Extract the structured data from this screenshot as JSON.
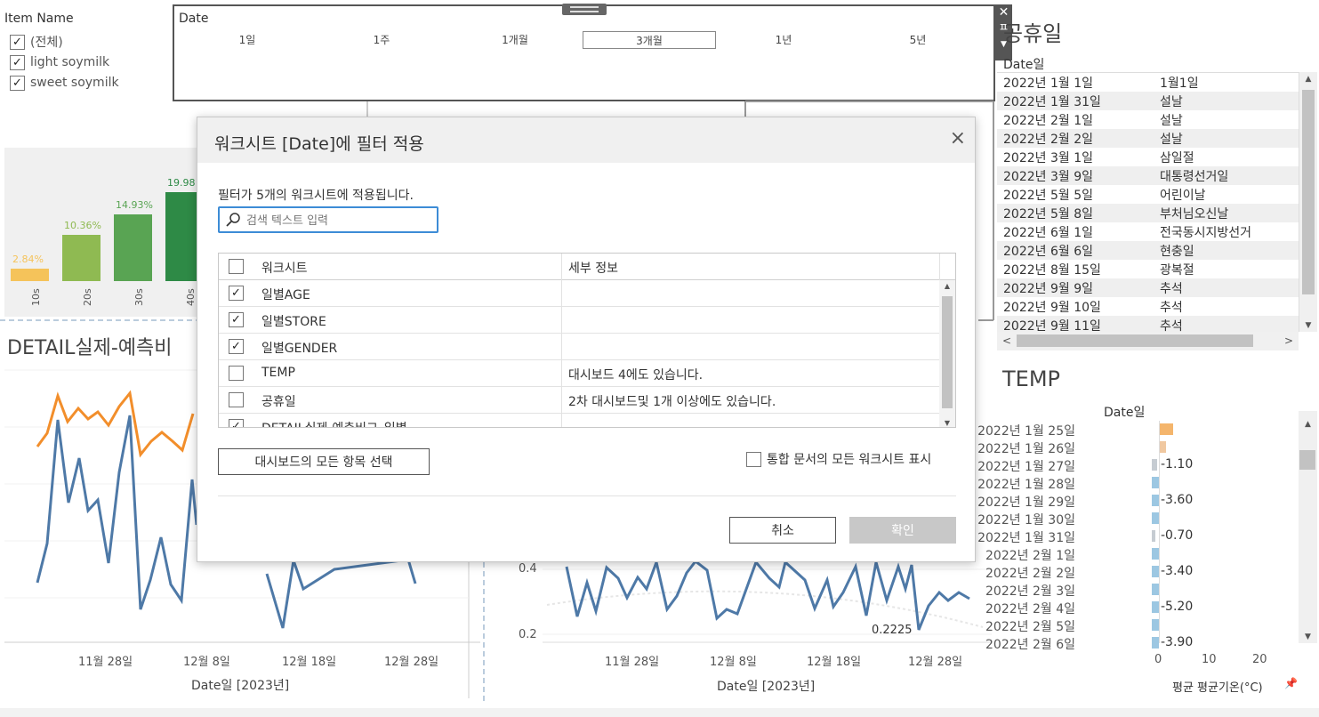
{
  "legend": {
    "title": "Item Name",
    "items": [
      {
        "label": "(전체)",
        "checked": true
      },
      {
        "label": "light soymilk",
        "checked": true
      },
      {
        "label": "sweet soymilk",
        "checked": true
      }
    ]
  },
  "date_filter": {
    "title": "Date",
    "options": [
      "1일",
      "1주",
      "1개월",
      "3개월",
      "1년",
      "5년"
    ],
    "selected": "3개월",
    "side_glyph": "ㅍ"
  },
  "age_chart": {
    "categories": [
      "10s",
      "20s",
      "30s",
      "40s"
    ],
    "labels": [
      "2.84%",
      "10.36%",
      "14.93%",
      "19.98"
    ],
    "values": [
      2.84,
      10.36,
      14.93,
      19.98
    ],
    "colors": [
      "#f5c35a",
      "#8fba52",
      "#59a453",
      "#2e8a46"
    ]
  },
  "detail": {
    "title": "DETAIL실제-예측비",
    "x_ticks": [
      "11월 28일",
      "12월 8일",
      "12월 18일",
      "12월 28일"
    ],
    "x_axis_label": "Date일 [2023년]"
  },
  "right_line": {
    "x_ticks": [
      "11월 28일",
      "12월 8일",
      "12월 18일",
      "12월 28일"
    ],
    "x_axis_label": "Date일 [2023년]",
    "y_ticks": [
      "0.4",
      "0.2"
    ],
    "annotation": "0.2225"
  },
  "holiday": {
    "title": "공휴일",
    "column_header": "Date일",
    "rows": [
      {
        "date": "2022년 1월 1일",
        "name": "1월1일"
      },
      {
        "date": "2022년 1월 31일",
        "name": "설날"
      },
      {
        "date": "2022년 2월 1일",
        "name": "설날"
      },
      {
        "date": "2022년 2월 2일",
        "name": "설날"
      },
      {
        "date": "2022년 3월 1일",
        "name": "삼일절"
      },
      {
        "date": "2022년 3월 9일",
        "name": "대통령선거일"
      },
      {
        "date": "2022년 5월 5일",
        "name": "어린이날"
      },
      {
        "date": "2022년 5월 8일",
        "name": "부처님오신날"
      },
      {
        "date": "2022년 6월 1일",
        "name": "전국동시지방선거"
      },
      {
        "date": "2022년 6월 6일",
        "name": "현충일"
      },
      {
        "date": "2022년 8월 15일",
        "name": "광복절"
      },
      {
        "date": "2022년 9월 9일",
        "name": "추석"
      },
      {
        "date": "2022년 9월 10일",
        "name": "추석"
      },
      {
        "date": "2022년 9월 11일",
        "name": "추석"
      }
    ]
  },
  "temp": {
    "title": "TEMP",
    "column_header": "Date일",
    "axis_ticks": [
      "0",
      "10",
      "20"
    ],
    "axis_label": "평균 평균기온(°C)",
    "rows": [
      {
        "date": "2022년 1월 25일",
        "value": 2.6,
        "label": ""
      },
      {
        "date": "2022년 1월 26일",
        "value": 1.2,
        "label": ""
      },
      {
        "date": "2022년 1월 27일",
        "value": -1.1,
        "label": "-1.10"
      },
      {
        "date": "2022년 1월 28일",
        "value": -1.6,
        "label": ""
      },
      {
        "date": "2022년 1월 29일",
        "value": -3.6,
        "label": "-3.60"
      },
      {
        "date": "2022년 1월 30일",
        "value": -1.6,
        "label": ""
      },
      {
        "date": "2022년 1월 31일",
        "value": -0.7,
        "label": "-0.70"
      },
      {
        "date": "2022년 2월 1일",
        "value": -1.6,
        "label": ""
      },
      {
        "date": "2022년 2월 2일",
        "value": -3.4,
        "label": "-3.40"
      },
      {
        "date": "2022년 2월 3일",
        "value": -1.6,
        "label": ""
      },
      {
        "date": "2022년 2월 4일",
        "value": -5.2,
        "label": "-5.20"
      },
      {
        "date": "2022년 2월 5일",
        "value": -1.6,
        "label": ""
      },
      {
        "date": "2022년 2월 6일",
        "value": -3.9,
        "label": "-3.90"
      }
    ]
  },
  "dialog": {
    "title": "워크시트 [Date]에 필터 적용",
    "description": "필터가 5개의 워크시트에 적용됩니다.",
    "search_placeholder": "검색 텍스트 입력",
    "col_worksheet": "워크시트",
    "col_detail": "세부 정보",
    "rows": [
      {
        "name": "일별AGE",
        "detail": "",
        "checked": true
      },
      {
        "name": "일별STORE",
        "detail": "",
        "checked": true
      },
      {
        "name": "일별GENDER",
        "detail": "",
        "checked": true
      },
      {
        "name": "TEMP",
        "detail": "대시보드 4에도 있습니다.",
        "checked": false
      },
      {
        "name": "공휴일",
        "detail": "2차 대시보드및 1개 이상에도 있습니다.",
        "checked": false
      },
      {
        "name": "DETAIL실제-예측비교_일별",
        "detail": "",
        "checked": true
      }
    ],
    "select_all_button": "대시보드의 모든 항목 선택",
    "show_all_label": "통합 문서의 모든 워크시트 표시",
    "cancel_button": "취소",
    "ok_button": "확인",
    "close_glyph": "×"
  },
  "colors": {
    "orange": "#f28e2b",
    "blue": "#4e79a7",
    "accent_blue": "#3d8cd6"
  }
}
